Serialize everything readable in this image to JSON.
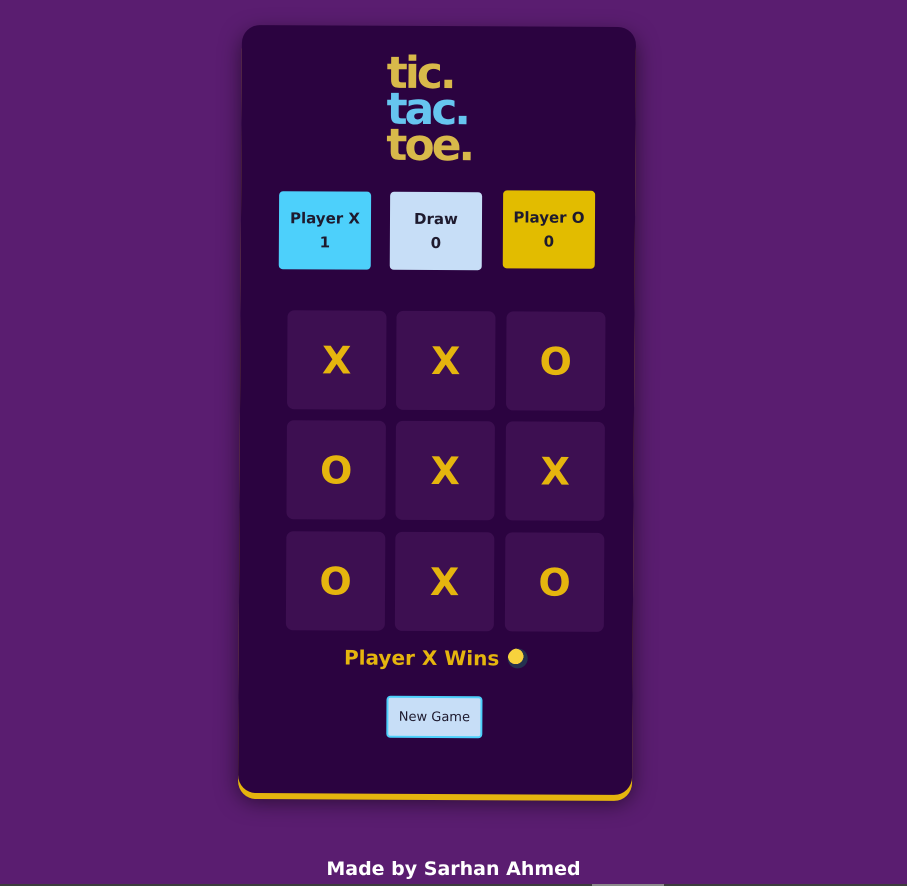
{
  "logo": {
    "line1": "tic.",
    "line2": "tac.",
    "line3": "toe."
  },
  "scores": {
    "player_x": {
      "label": "Player X",
      "value": "1"
    },
    "draw": {
      "label": "Draw",
      "value": "0"
    },
    "player_o": {
      "label": "Player O",
      "value": "0"
    }
  },
  "board": {
    "cells": [
      "X",
      "X",
      "O",
      "O",
      "X",
      "X",
      "O",
      "X",
      "O"
    ]
  },
  "status": {
    "text": "Player X Wins"
  },
  "new_game_label": "New Game",
  "footer": "Made by Sarhan Ahmed",
  "colors": {
    "background": "#5a1d70",
    "card": "#2b0340",
    "cell": "#3d0f51",
    "accent_gold": "#e5b50e",
    "player_x": "#4dd0fb",
    "draw": "#c7def7",
    "player_o": "#e2bc00"
  }
}
